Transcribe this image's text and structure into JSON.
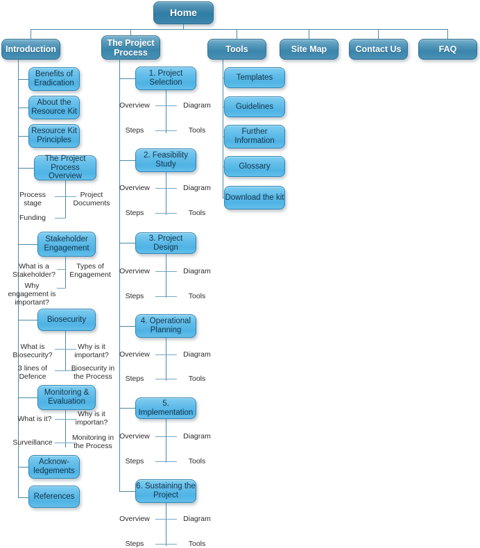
{
  "diagram": {
    "title": "Home",
    "colors": {
      "level1_box": "#2F7CA4",
      "level2_box": "#3A85AC",
      "level3_box": "#4FB3E4",
      "connector": "#4A86A8",
      "level3_text": "#14344A",
      "leaf_text": "#2A2A2A",
      "background": "#FFFFFF"
    }
  },
  "root": {
    "label": "Home"
  },
  "top_nav": [
    {
      "label": "Introduction"
    },
    {
      "label": "The Project Process"
    },
    {
      "label": "Tools"
    },
    {
      "label": "Site Map"
    },
    {
      "label": "Contact Us"
    },
    {
      "label": "FAQ"
    }
  ],
  "introduction": {
    "label": "Introduction",
    "children": [
      {
        "label": "Benefits of Eradication",
        "leaves": []
      },
      {
        "label": "About the Resource Kit",
        "leaves": []
      },
      {
        "label": "Resource Kit Principles",
        "leaves": []
      },
      {
        "label": "The Project Process Overview",
        "leaves": [
          {
            "left": "Process stage",
            "right": "Project Documents"
          },
          {
            "left": "Funding",
            "right": ""
          }
        ]
      },
      {
        "label": "Stakeholder Engagement",
        "leaves": [
          {
            "left": "What is a Stakeholder?",
            "right": "Types of Engagement"
          },
          {
            "left": "Why engagement is important?",
            "right": ""
          }
        ]
      },
      {
        "label": "Biosecurity",
        "leaves": [
          {
            "left": "What is Biosecurity?",
            "right": "Why is it important?"
          },
          {
            "left": "3 lines of Defence",
            "right": "Biosecurity in the Process"
          }
        ]
      },
      {
        "label": "Monitoring & Evaluation",
        "leaves": [
          {
            "left": "What is it?",
            "right": "Why is it importan?"
          },
          {
            "left": "Surveillance",
            "right": "Monitoring in the Process"
          }
        ]
      },
      {
        "label": "Acknow-ledgements",
        "leaves": []
      },
      {
        "label": "References",
        "leaves": []
      }
    ]
  },
  "project_process": {
    "label": "The Project Process",
    "children": [
      {
        "label": "1. Project Selection",
        "leaves": [
          {
            "left": "Overview",
            "right": "Diagram"
          },
          {
            "left": "Steps",
            "right": "Tools"
          }
        ]
      },
      {
        "label": "2. Feasibility Study",
        "leaves": [
          {
            "left": "Overview",
            "right": "Diagram"
          },
          {
            "left": "Steps",
            "right": "Tools"
          }
        ]
      },
      {
        "label": "3. Project Design",
        "leaves": [
          {
            "left": "Overview",
            "right": "Diagram"
          },
          {
            "left": "Steps",
            "right": "Tools"
          }
        ]
      },
      {
        "label": "4. Operational Planning",
        "leaves": [
          {
            "left": "Overview",
            "right": "Diagram"
          },
          {
            "left": "Steps",
            "right": "Tools"
          }
        ]
      },
      {
        "label": "5. Implementation",
        "leaves": [
          {
            "left": "Overview",
            "right": "Diagram"
          },
          {
            "left": "Steps",
            "right": "Tools"
          }
        ]
      },
      {
        "label": "6. Sustaining the Project",
        "leaves": [
          {
            "left": "Overview",
            "right": "Diagram"
          },
          {
            "left": "Steps",
            "right": "Tools"
          }
        ]
      }
    ]
  },
  "tools": {
    "label": "Tools",
    "children": [
      {
        "label": "Templates"
      },
      {
        "label": "Guidelines"
      },
      {
        "label": "Further Information"
      },
      {
        "label": "Glossary"
      },
      {
        "label": "Download the kit"
      }
    ]
  }
}
